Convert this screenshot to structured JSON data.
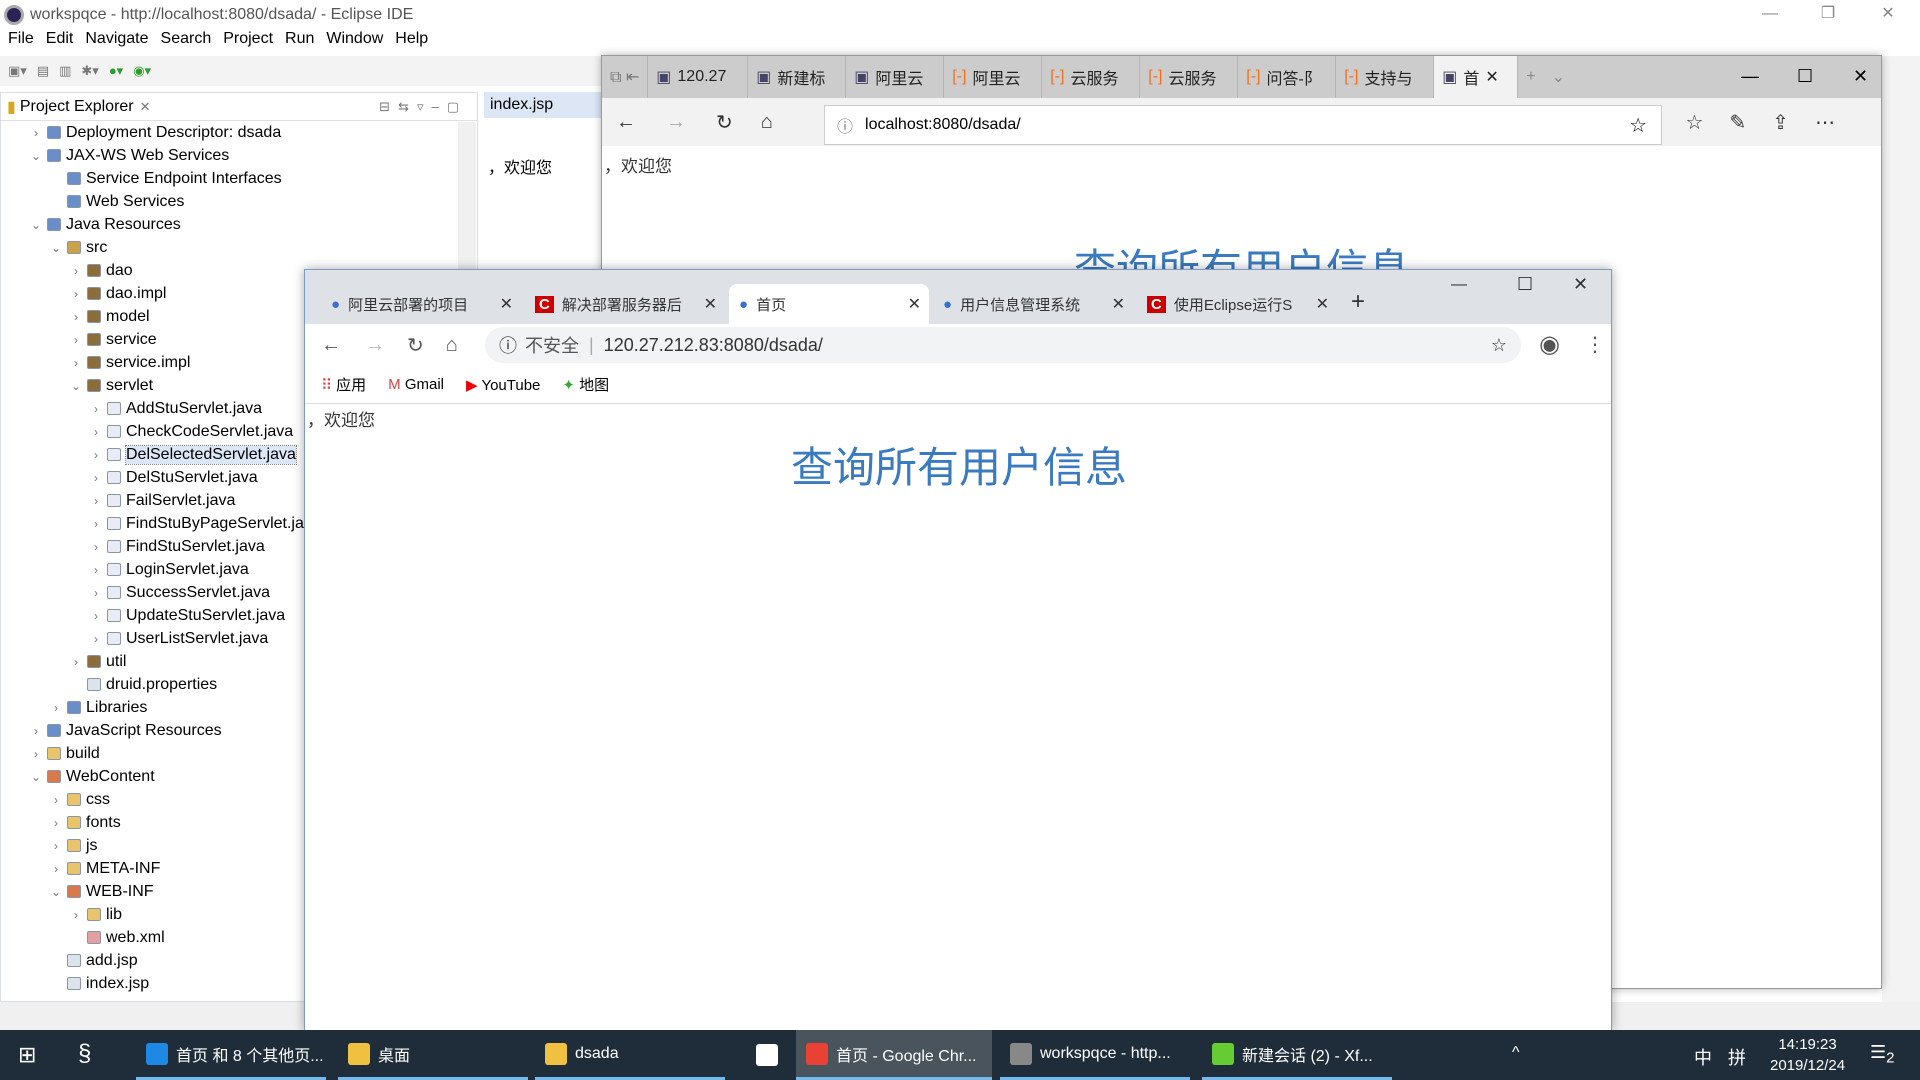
{
  "eclipse": {
    "title": "workspqce - http://localhost:8080/dsada/ - Eclipse IDE",
    "menu": [
      "File",
      "Edit",
      "Navigate",
      "Search",
      "Project",
      "Run",
      "Window",
      "Help"
    ],
    "explorer_title": "Project Explorer",
    "editor_tab": "index.jsp",
    "editor_text": "，欢迎您",
    "tree": [
      {
        "label": "Deployment Descriptor: dsada",
        "level": 0,
        "state": "collapsed",
        "icon": "descriptor-icon"
      },
      {
        "label": "JAX-WS Web Services",
        "level": 0,
        "state": "expanded",
        "icon": "webservice-icon"
      },
      {
        "label": "Service Endpoint Interfaces",
        "level": 1,
        "state": "leaf",
        "icon": "endpoint-icon"
      },
      {
        "label": "Web Services",
        "level": 1,
        "state": "leaf",
        "icon": "webservice-icon"
      },
      {
        "label": "Java Resources",
        "level": 0,
        "state": "expanded",
        "icon": "java-resources-icon"
      },
      {
        "label": "src",
        "level": 1,
        "state": "expanded",
        "icon": "source-folder-icon"
      },
      {
        "label": "dao",
        "level": 2,
        "state": "collapsed",
        "icon": "package-icon"
      },
      {
        "label": "dao.impl",
        "level": 2,
        "state": "collapsed",
        "icon": "package-icon"
      },
      {
        "label": "model",
        "level": 2,
        "state": "collapsed",
        "icon": "package-icon"
      },
      {
        "label": "service",
        "level": 2,
        "state": "collapsed",
        "icon": "package-icon"
      },
      {
        "label": "service.impl",
        "level": 2,
        "state": "collapsed",
        "icon": "package-icon"
      },
      {
        "label": "servlet",
        "level": 2,
        "state": "expanded",
        "icon": "package-icon"
      },
      {
        "label": "AddStuServlet.java",
        "level": 3,
        "state": "collapsed",
        "icon": "java-file-icon"
      },
      {
        "label": "CheckCodeServlet.java",
        "level": 3,
        "state": "collapsed",
        "icon": "java-file-icon"
      },
      {
        "label": "DelSelectedServlet.java",
        "level": 3,
        "state": "collapsed",
        "icon": "java-file-icon",
        "selected": true
      },
      {
        "label": "DelStuServlet.java",
        "level": 3,
        "state": "collapsed",
        "icon": "java-file-icon"
      },
      {
        "label": "FailServlet.java",
        "level": 3,
        "state": "collapsed",
        "icon": "java-file-icon"
      },
      {
        "label": "FindStuByPageServlet.ja",
        "level": 3,
        "state": "collapsed",
        "icon": "java-file-icon"
      },
      {
        "label": "FindStuServlet.java",
        "level": 3,
        "state": "collapsed",
        "icon": "java-file-icon"
      },
      {
        "label": "LoginServlet.java",
        "level": 3,
        "state": "collapsed",
        "icon": "java-file-icon"
      },
      {
        "label": "SuccessServlet.java",
        "level": 3,
        "state": "collapsed",
        "icon": "java-file-icon"
      },
      {
        "label": "UpdateStuServlet.java",
        "level": 3,
        "state": "collapsed",
        "icon": "java-file-icon"
      },
      {
        "label": "UserListServlet.java",
        "level": 3,
        "state": "collapsed",
        "icon": "java-file-icon"
      },
      {
        "label": "util",
        "level": 2,
        "state": "collapsed",
        "icon": "package-icon"
      },
      {
        "label": "druid.properties",
        "level": 2,
        "state": "leaf",
        "icon": "file-icon"
      },
      {
        "label": "Libraries",
        "level": 1,
        "state": "collapsed",
        "icon": "library-icon"
      },
      {
        "label": "JavaScript Resources",
        "level": 0,
        "state": "collapsed",
        "icon": "js-resources-icon"
      },
      {
        "label": "build",
        "level": 0,
        "state": "collapsed",
        "icon": "folder-icon"
      },
      {
        "label": "WebContent",
        "level": 0,
        "state": "expanded",
        "icon": "web-folder-icon"
      },
      {
        "label": "css",
        "level": 1,
        "state": "collapsed",
        "icon": "folder-icon"
      },
      {
        "label": "fonts",
        "level": 1,
        "state": "collapsed",
        "icon": "folder-icon"
      },
      {
        "label": "js",
        "level": 1,
        "state": "collapsed",
        "icon": "folder-icon"
      },
      {
        "label": "META-INF",
        "level": 1,
        "state": "collapsed",
        "icon": "folder-icon"
      },
      {
        "label": "WEB-INF",
        "level": 1,
        "state": "expanded",
        "icon": "web-folder-icon"
      },
      {
        "label": "lib",
        "level": 2,
        "state": "collapsed",
        "icon": "folder-icon"
      },
      {
        "label": "web.xml",
        "level": 2,
        "state": "leaf",
        "icon": "xml-file-icon"
      },
      {
        "label": "add.jsp",
        "level": 1,
        "state": "leaf",
        "icon": "file-icon"
      },
      {
        "label": "index.jsp",
        "level": 1,
        "state": "leaf",
        "icon": "file-icon"
      }
    ]
  },
  "edge": {
    "tabs": [
      "120.27",
      "新建标",
      "阿里云",
      "阿里云",
      "云服务",
      "云服务",
      "问答-阝",
      "支持与",
      "首"
    ],
    "url": "localhost:8080/dsada/",
    "welcome": "，欢迎您",
    "heading": "查询所有用户信息"
  },
  "chrome": {
    "tabs": [
      "阿里云部署的项目",
      "解决部署服务器后",
      "首页",
      "用户信息管理系统",
      "使用Eclipse运行S"
    ],
    "active_tab": 2,
    "security": "不安全",
    "url": "120.27.212.83:8080/dsada/",
    "bookmarks": [
      "应用",
      "Gmail",
      "YouTube",
      "地图"
    ],
    "welcome": "，欢迎您",
    "heading": "查询所有用户信息"
  },
  "taskbar": {
    "items": [
      "首页 和 8 个其他页...",
      "桌面",
      "dsada",
      "首页 - Google Chr...",
      "workspqce - http...",
      "新建会话 (2)  - Xf..."
    ],
    "ime": "中",
    "time": "14:19:23",
    "date": "2019/12/24",
    "notifications": "2"
  },
  "colors": {
    "heading": "#3a7ac0",
    "taskbar": "#1f2d3a"
  }
}
